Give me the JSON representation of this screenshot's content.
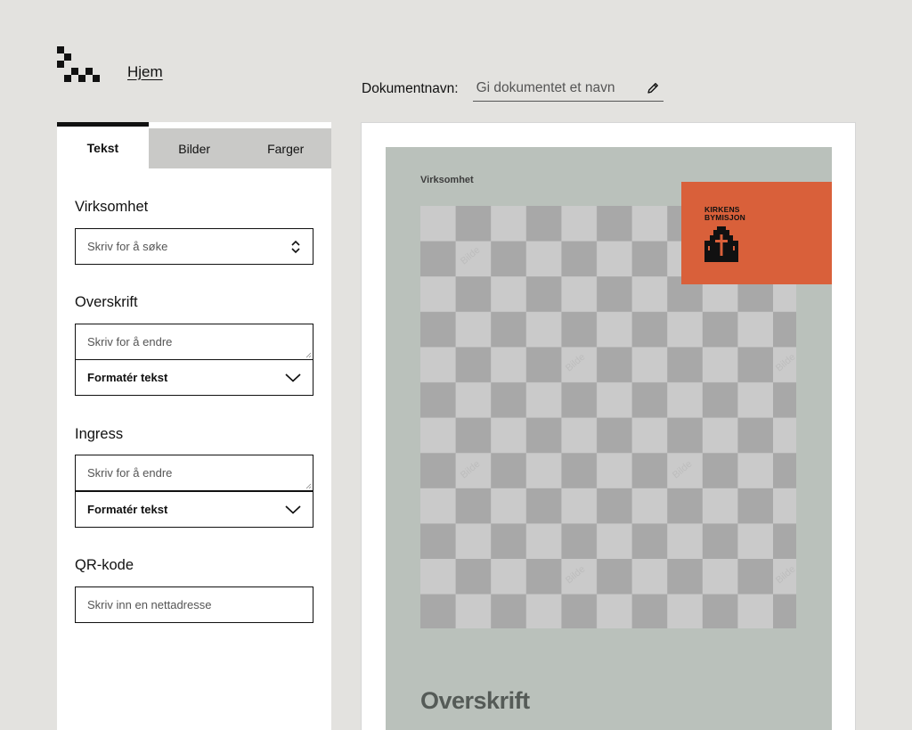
{
  "nav": {
    "home_label": "Hjem"
  },
  "document": {
    "name_label": "Dokumentnavn:",
    "name_placeholder": "Gi dokumentet et navn"
  },
  "tabs": [
    {
      "label": "Tekst",
      "active": true
    },
    {
      "label": "Bilder",
      "active": false
    },
    {
      "label": "Farger",
      "active": false
    }
  ],
  "form": {
    "business": {
      "title": "Virksomhet",
      "placeholder": "Skriv for å søke"
    },
    "headline": {
      "title": "Overskrift",
      "placeholder": "Skriv for å endre",
      "format_label": "Formatér tekst"
    },
    "ingress": {
      "title": "Ingress",
      "placeholder": "Skriv for å endre",
      "format_label": "Formatér tekst"
    },
    "qr": {
      "title": "QR-kode",
      "placeholder": "Skriv inn en nettadresse"
    }
  },
  "preview": {
    "business_text": "Virksomhet",
    "image_watermark": "Bilde",
    "logo_line1": "KIRKENS",
    "logo_line2": "BYMISJON",
    "headline_text": "Overskrift"
  },
  "colors": {
    "page_bg": "#e3e2df",
    "poster_bg": "#bac1bb",
    "logo_block": "#d9603a"
  }
}
